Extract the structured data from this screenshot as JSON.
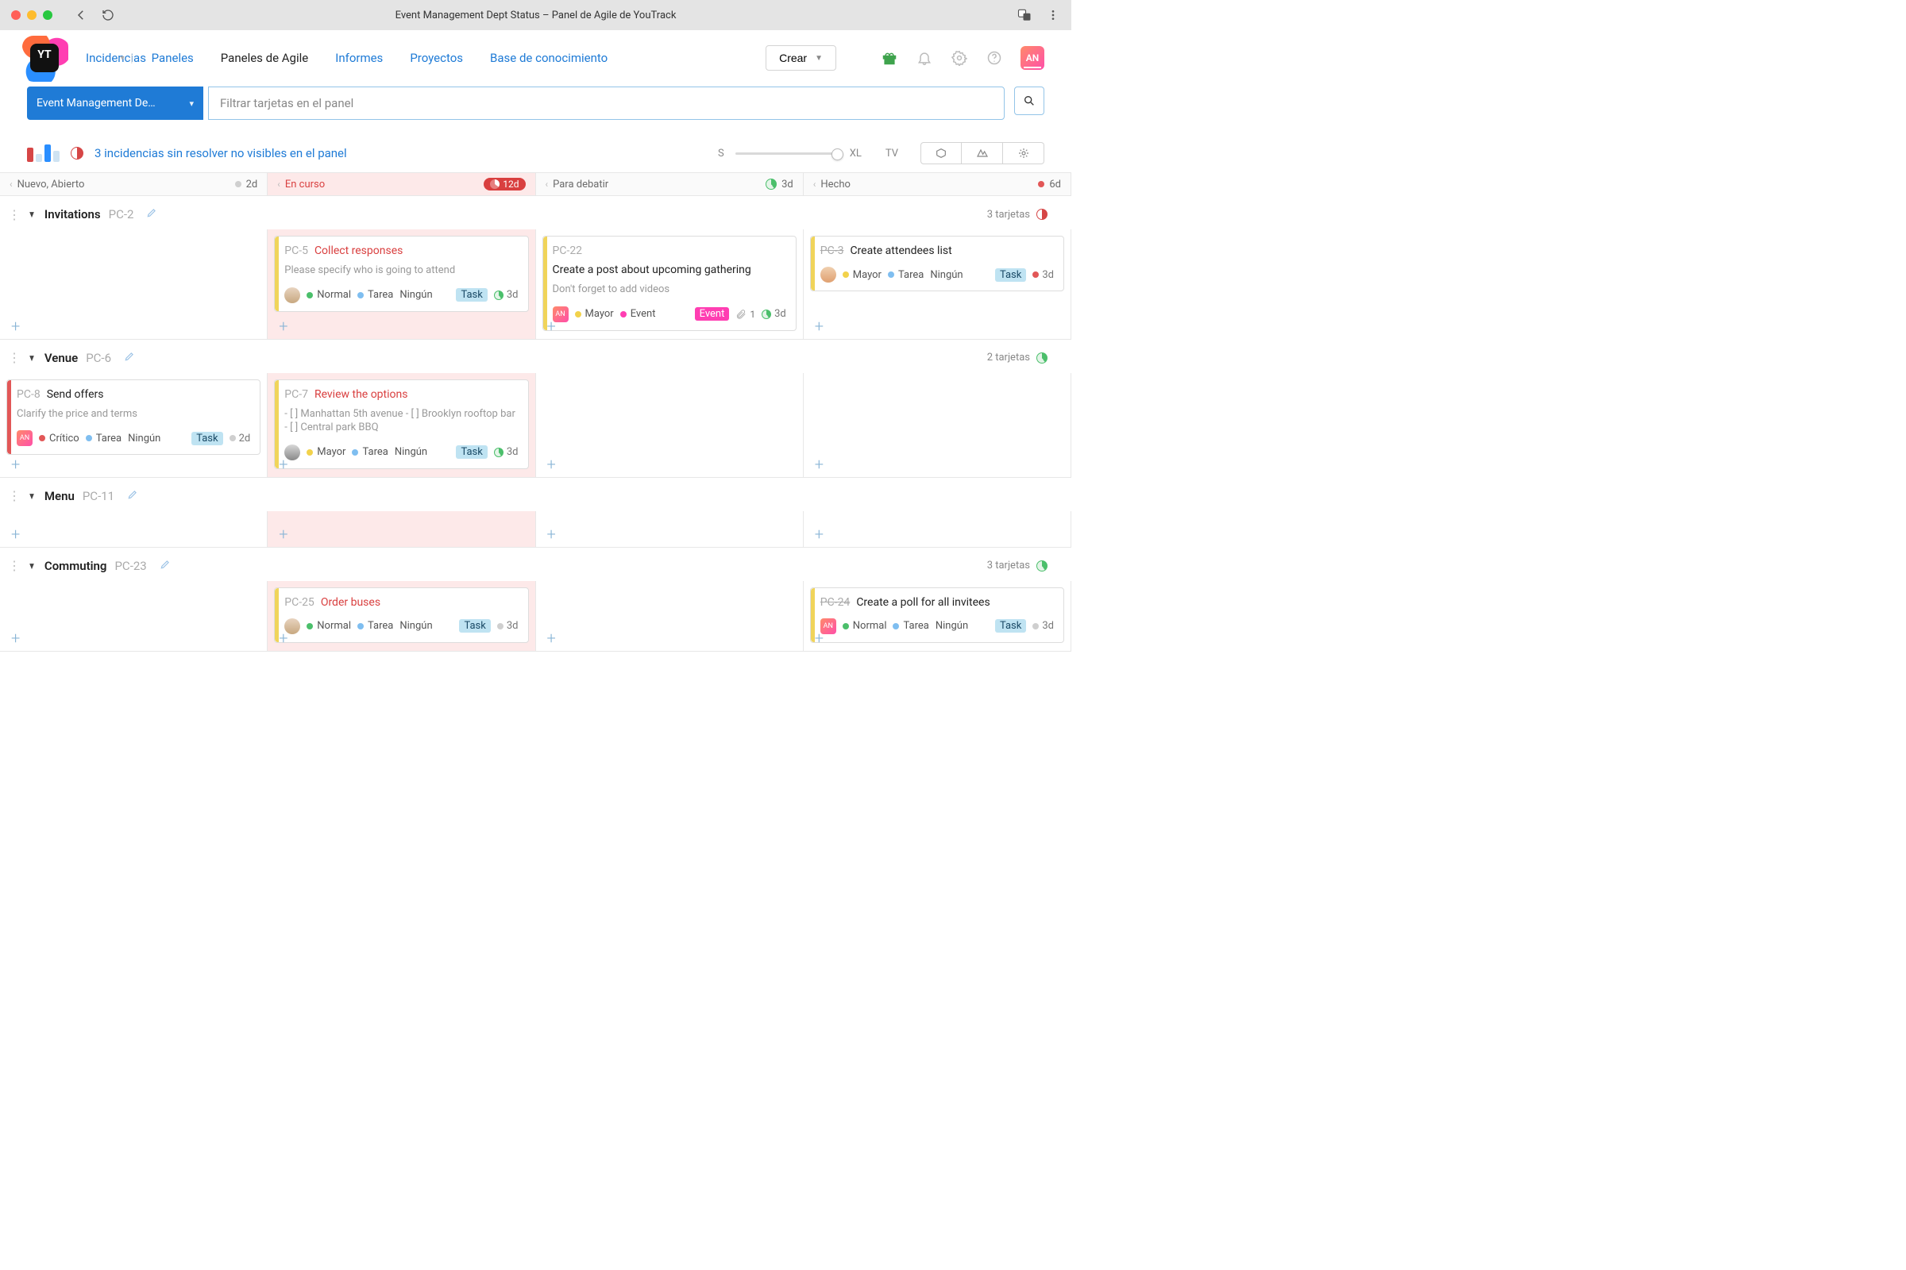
{
  "window": {
    "title": "Event Management Dept Status – Panel de Agile de YouTrack"
  },
  "header": {
    "logo_text": "YT",
    "nav": {
      "issues": "Incidencias",
      "dashboards": "Paneles",
      "agile": "Paneles de Agile",
      "reports": "Informes",
      "projects": "Proyectos",
      "kb": "Base de conocimiento"
    },
    "create": "Crear",
    "avatar_initials": "AN"
  },
  "boardbar": {
    "board_name": "Event Management De…",
    "filter_placeholder": "Filtrar tarjetas en el panel"
  },
  "controls": {
    "unresolved": "3 incidencias sin resolver no visibles en el panel",
    "size_s": "S",
    "size_xl": "XL",
    "tv": "TV"
  },
  "columns": [
    {
      "name": "Nuevo, Abierto",
      "days": "2d",
      "style": "grey"
    },
    {
      "name": "En curso",
      "days": "12d",
      "style": "red"
    },
    {
      "name": "Para debatir",
      "days": "3d",
      "style": "green"
    },
    {
      "name": "Hecho",
      "days": "6d",
      "style": "red-dot"
    }
  ],
  "swimlanes": [
    {
      "name": "Invitations",
      "id": "PC-2",
      "summary": "3 tarjetas",
      "cells": [
        [],
        [
          {
            "id": "PC-5",
            "title": "Collect responses",
            "title_color": "red",
            "bar": "yellow",
            "desc": "Please specify who is going to attend",
            "avatar": "person1",
            "priority": "Normal",
            "priority_dot": "green",
            "type": "Tarea",
            "type_dot": "blue",
            "sprint": "Ningún",
            "tags": [
              {
                "kind": "task",
                "label": "Task"
              }
            ],
            "est": "3d",
            "est_pie": "green"
          }
        ],
        [
          {
            "id": "PC-22",
            "title": "Create a post about upcoming gathering",
            "title_color": "black",
            "bar": "yellow",
            "desc": "Don't forget to add videos",
            "avatar": "grad",
            "avatar_txt": "AN",
            "priority": "Mayor",
            "priority_dot": "yellow",
            "type": "Event",
            "type_dot": "pink",
            "tags": [
              {
                "kind": "event",
                "label": "Event"
              }
            ],
            "attach_count": "1",
            "est": "3d",
            "est_pie": "green"
          }
        ],
        [
          {
            "id": "PC-3",
            "strike": true,
            "title": "Create attendees list",
            "title_color": "black",
            "bar": "yellow",
            "avatar": "person3",
            "priority": "Mayor",
            "priority_dot": "yellow",
            "type": "Tarea",
            "type_dot": "blue",
            "sprint": "Ningún",
            "tags": [
              {
                "kind": "task",
                "label": "Task"
              }
            ],
            "est": "3d",
            "est_dot": "red"
          }
        ]
      ]
    },
    {
      "name": "Venue",
      "id": "PC-6",
      "summary": "2 tarjetas",
      "cells": [
        [
          {
            "id": "PC-8",
            "title": "Send offers",
            "title_color": "black",
            "bar": "red",
            "desc": "Clarify the price and terms",
            "avatar": "grad",
            "avatar_txt": "AN",
            "priority": "Crítico",
            "priority_dot": "red",
            "type": "Tarea",
            "type_dot": "blue",
            "sprint": "Ningún",
            "tags": [
              {
                "kind": "task",
                "label": "Task"
              }
            ],
            "est": "2d",
            "est_dot": "grey"
          }
        ],
        [
          {
            "id": "PC-7",
            "title": "Review the options",
            "title_color": "red",
            "bar": "yellow",
            "desc": "- [ ] Manhattan 5th avenue - [ ] Brooklyn rooftop bar - [ ] Central park BBQ",
            "avatar": "person2",
            "priority": "Mayor",
            "priority_dot": "yellow",
            "type": "Tarea",
            "type_dot": "blue",
            "sprint": "Ningún",
            "tags": [
              {
                "kind": "task",
                "label": "Task"
              }
            ],
            "est": "3d",
            "est_pie": "green"
          }
        ],
        [],
        []
      ]
    },
    {
      "name": "Menu",
      "id": "PC-11",
      "summary": "",
      "cells": [
        [],
        [],
        [],
        []
      ]
    },
    {
      "name": "Commuting",
      "id": "PC-23",
      "summary": "3 tarjetas",
      "cells": [
        [],
        [
          {
            "id": "PC-25",
            "title": "Order buses",
            "title_color": "red",
            "bar": "yellow",
            "avatar": "person1",
            "priority": "Normal",
            "priority_dot": "green",
            "type": "Tarea",
            "type_dot": "blue",
            "sprint": "Ningún",
            "tags": [
              {
                "kind": "task",
                "label": "Task"
              }
            ],
            "est": "3d",
            "est_dot": "grey"
          }
        ],
        [],
        [
          {
            "id": "PC-24",
            "strike": true,
            "title": "Create a poll for all invitees",
            "title_color": "black",
            "bar": "yellow",
            "avatar": "grad",
            "avatar_txt": "AN",
            "priority": "Normal",
            "priority_dot": "green",
            "type": "Tarea",
            "type_dot": "blue",
            "sprint": "Ningún",
            "tags": [
              {
                "kind": "task",
                "label": "Task"
              }
            ],
            "est": "3d",
            "est_dot": "grey"
          }
        ]
      ]
    }
  ]
}
